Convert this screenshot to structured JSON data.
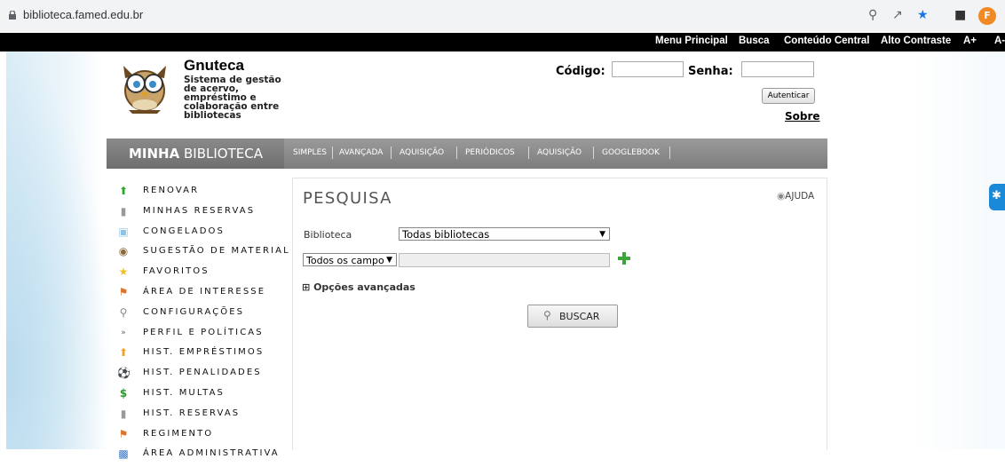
{
  "browser": {
    "url": "biblioteca.famed.edu.br",
    "profile_initial": "F"
  },
  "topnav": {
    "menu_principal": "Menu Principal",
    "busca": "Busca",
    "conteudo_central": "Conteúdo Central",
    "alto_contraste": "Alto Contraste",
    "a_plus": "A+",
    "a_minus": "A-"
  },
  "brand": {
    "title": "Gnuteca",
    "subtitle": "Sistema de gestão de acervo, empréstimo e colaboração entre bibliotecas"
  },
  "login": {
    "codigo_label": "Código:",
    "senha_label": "Senha:",
    "autenticar": "Autenticar",
    "sobre": "Sobre"
  },
  "menubar": {
    "minha": "MINHA",
    "biblioteca": "BIBLIOTECA",
    "tabs": [
      "SIMPLES",
      "AVANÇADA",
      "AQUISIÇÃO",
      "PERIÓDICOS",
      "AQUISIÇÃO",
      "GOOGLEBOOK"
    ]
  },
  "sidebar": {
    "items": [
      {
        "label": "RENOVAR",
        "icon": "green-up-arrow-icon"
      },
      {
        "label": "MINHAS RESERVAS",
        "icon": "book-icon"
      },
      {
        "label": "CONGELADOS",
        "icon": "ice-cube-icon"
      },
      {
        "label": "SUGESTÃO DE MATERIAL",
        "icon": "owl-icon"
      },
      {
        "label": "FAVORITOS",
        "icon": "star-icon"
      },
      {
        "label": "ÁREA DE INTERESSE",
        "icon": "pushpin-icon"
      },
      {
        "label": "CONFIGURAÇÕES",
        "icon": "magnifier-icon"
      },
      {
        "label": "PERFIL E POLÍTICAS",
        "icon": "chevron-right-icon"
      },
      {
        "label": "HIST. EMPRÉSTIMOS",
        "icon": "orange-up-arrow-icon"
      },
      {
        "label": "HIST. PENALIDADES",
        "icon": "ball-icon"
      },
      {
        "label": "HIST. MULTAS",
        "icon": "dollar-icon"
      },
      {
        "label": "HIST. RESERVAS",
        "icon": "book-icon"
      },
      {
        "label": "REGIMENTO",
        "icon": "pushpin-icon"
      },
      {
        "label": "ÁREA ADMINISTRATIVA",
        "icon": "admin-icon"
      }
    ]
  },
  "search": {
    "title": "PESQUISA",
    "ajuda": "AJUDA",
    "biblioteca_label": "Biblioteca",
    "biblioteca_value": "Todas bibliotecas",
    "campo_value": "Todos os campos",
    "opcoes": "Opções avançadas",
    "buscar": "BUSCAR"
  }
}
